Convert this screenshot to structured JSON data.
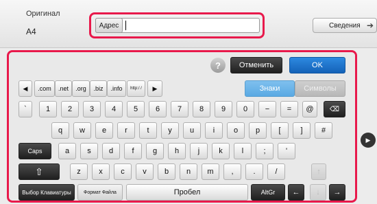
{
  "header": {
    "original_label": "Оригинал",
    "original_value": "A4",
    "address_label": "Адрес",
    "address_value": "",
    "info_button": "Сведения"
  },
  "keyboard": {
    "cancel": "Отменить",
    "ok": "OK",
    "domains": [
      ".com",
      ".net",
      ".org",
      ".biz",
      ".info",
      "http:/ /"
    ],
    "mode_keys": {
      "chars": "Знаки",
      "symbols": "Символы"
    },
    "row1": [
      "`",
      "1",
      "2",
      "3",
      "4",
      "5",
      "6",
      "7",
      "8",
      "9",
      "0",
      "−",
      "=",
      "@"
    ],
    "row2": [
      "q",
      "w",
      "e",
      "r",
      "t",
      "y",
      "u",
      "i",
      "o",
      "p",
      "[",
      "]",
      "#"
    ],
    "row3": [
      "a",
      "s",
      "d",
      "f",
      "g",
      "h",
      "j",
      "k",
      "l",
      ";",
      "'"
    ],
    "row4": [
      "z",
      "x",
      "c",
      "v",
      "b",
      "n",
      "m",
      ",",
      ".",
      "/"
    ],
    "caps": "Caps",
    "layout_select": "Выбор Клавиатуры",
    "file_format": "Формат Файла",
    "space": "Пробел",
    "altgr": "AltGr"
  },
  "colors": {
    "highlight": "#e8194b",
    "ok_blue": "#1c6fc6",
    "chars_blue": "#6cb4e8"
  }
}
